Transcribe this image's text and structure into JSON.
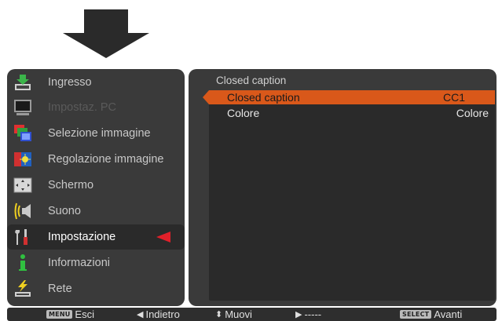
{
  "menu": {
    "items": [
      {
        "label": "Ingresso",
        "icon": "input-icon",
        "state": "normal"
      },
      {
        "label": "Impostaz. PC",
        "icon": "pc-monitor-icon",
        "state": "disabled"
      },
      {
        "label": "Selezione immagine",
        "icon": "image-select-icon",
        "state": "normal"
      },
      {
        "label": "Regolazione immagine",
        "icon": "image-adjust-icon",
        "state": "normal"
      },
      {
        "label": "Schermo",
        "icon": "screen-icon",
        "state": "normal"
      },
      {
        "label": "Suono",
        "icon": "sound-icon",
        "state": "normal"
      },
      {
        "label": "Impostazione",
        "icon": "settings-tools-icon",
        "state": "selected"
      },
      {
        "label": "Informazioni",
        "icon": "info-icon",
        "state": "normal"
      },
      {
        "label": "Rete",
        "icon": "network-icon",
        "state": "normal"
      }
    ]
  },
  "submenu": {
    "title": "Closed caption",
    "rows": [
      {
        "label": "Closed caption",
        "value": "CC1",
        "highlighted": true
      },
      {
        "label": "Colore",
        "value": "Colore",
        "highlighted": false
      }
    ]
  },
  "bottom_bar": {
    "menu_key": "MENU",
    "exit": "Esci",
    "back": "Indietro",
    "move": "Muovi",
    "next_dashes": "-----",
    "select_key": "SELECT",
    "forward": "Avanti"
  },
  "colors": {
    "highlight": "#d9581a",
    "pointer": "#e0202a",
    "panel": "#3a3a3a"
  }
}
